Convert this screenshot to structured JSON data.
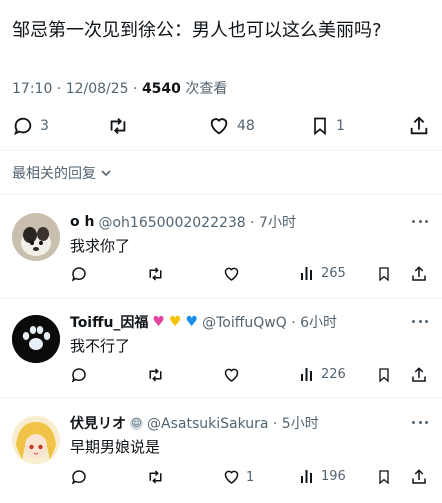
{
  "tweet": {
    "text": "邹忌第一次见到徐公：男人也可以这么美丽吗?",
    "time": "17:10 · 12/08/25 · ",
    "views_count": "4540",
    "views_label": " 次查看",
    "replies": "3",
    "likes": "48",
    "bookmarks": "1"
  },
  "replies_section": {
    "label": "最相关的回复"
  },
  "replies": [
    {
      "name": "o h",
      "handle": "@oh1650002022238 · 7小时",
      "text": "我求你了",
      "views": "265",
      "likes": ""
    },
    {
      "name": "Toiffu_因福",
      "handle": "@ToiffuQwQ · 6小时",
      "text": "我不行了",
      "views": "226",
      "likes": ""
    },
    {
      "name": "伏見リオ",
      "handle": "@AsatsukiSakura · 5小时",
      "text": "早期男娘说是",
      "views": "196",
      "likes": "1"
    }
  ],
  "colors": {
    "text": "#0f1419",
    "secondary": "#536471",
    "divider": "#eff3f4"
  }
}
